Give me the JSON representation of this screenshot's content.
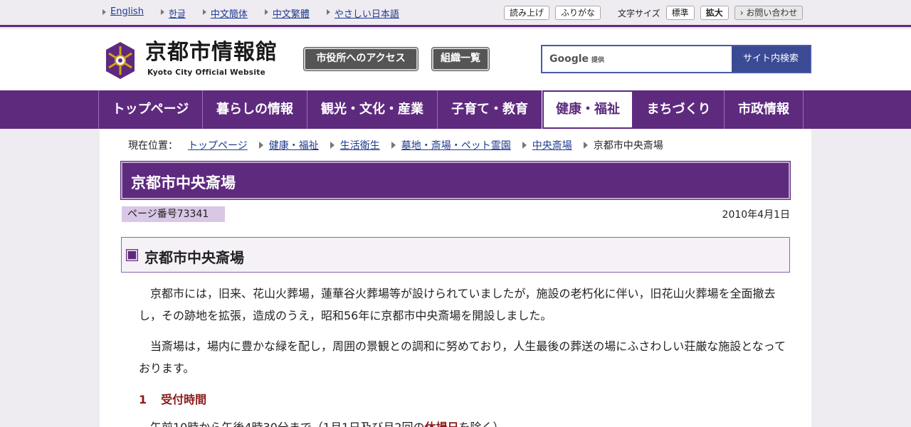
{
  "language_links": [
    "English",
    "한글",
    "中文簡体",
    "中文繁體",
    "やさしい日本語"
  ],
  "tools": {
    "read_aloud": "読み上げ",
    "furigana": "ふりがな",
    "font_size_label": "文字サイズ",
    "font_standard": "標準",
    "font_large": "拡大",
    "contact": "お問い合わせ"
  },
  "header": {
    "site_title": "京都市情報館",
    "site_subtitle": "Kyoto City Official Website",
    "access_button": "市役所へのアクセス",
    "org_button": "組織一覧",
    "search_brand": "Google",
    "search_brand_sub": "提供",
    "search_placeholder": "",
    "search_button": "サイト内検索"
  },
  "nav": [
    {
      "label": "トップページ",
      "active": false
    },
    {
      "label": "暮らしの情報",
      "active": false
    },
    {
      "label": "観光・文化・産業",
      "active": false
    },
    {
      "label": "子育て・教育",
      "active": false
    },
    {
      "label": "健康・福祉",
      "active": true
    },
    {
      "label": "まちづくり",
      "active": false
    },
    {
      "label": "市政情報",
      "active": false
    }
  ],
  "breadcrumb": {
    "label": "現在位置：",
    "items": [
      "トップページ",
      "健康・福祉",
      "生活衛生",
      "墓地・斎場・ペット霊園",
      "中央斎場"
    ],
    "current": "京都市中央斎場"
  },
  "page": {
    "title": "京都市中央斎場",
    "page_number": "ページ番号73341",
    "date": "2010年4月1日",
    "heading": "京都市中央斎場",
    "paragraph1": "京都市には，旧来、花山火葬場，蓮華谷火葬場等が設けられていましたが，施設の老朽化に伴い，旧花山火葬場を全面撤去し，その跡地を拡張，造成のうえ，昭和56年に京都市中央斎場を開設しました。",
    "paragraph2": "当斎場は，場内に豊かな緑を配し，周囲の景観との調和に努めており，人生最後の葬送の場にふさわしい荘厳な施設となっております。",
    "section_number": "1",
    "section_title": "受付時間",
    "hours_text_before": "午前10時から午後4時30分まで（1月1日及び月2回の",
    "hours_link": "休場日",
    "hours_text_after": "を除く）"
  },
  "colors": {
    "brand_purple": "#5e2a7e",
    "link_blue": "#1f3a8f",
    "search_button": "#3b4a94",
    "section_red": "#8a1a1a"
  }
}
